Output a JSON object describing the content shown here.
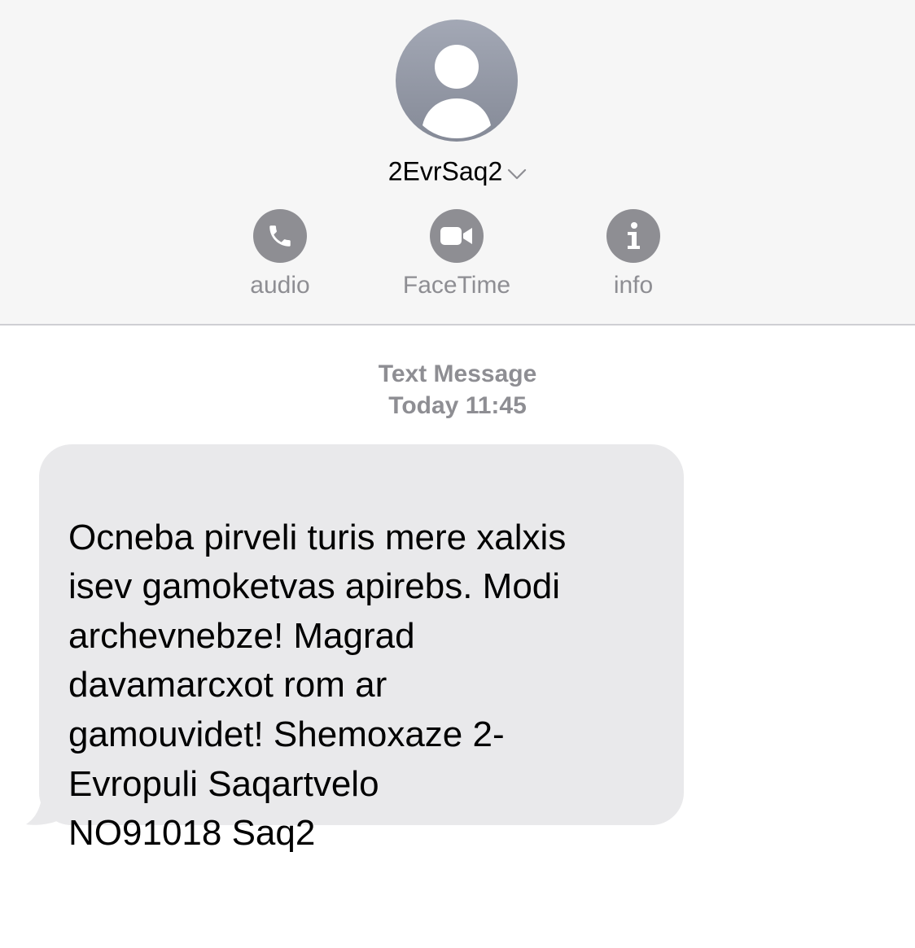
{
  "contact": {
    "name": "2EvrSaq2",
    "avatar_icon": "person-silhouette-icon",
    "expand_icon": "chevron-down-icon"
  },
  "actions": [
    {
      "label": "audio",
      "icon": "phone-icon"
    },
    {
      "label": "FaceTime",
      "icon": "video-camera-icon"
    },
    {
      "label": "info",
      "icon": "info-icon"
    }
  ],
  "thread": {
    "message_type": "Text Message",
    "timestamp": "Today 11:45"
  },
  "message": {
    "text": "Ocneba pirveli turis mere xalxis\nisev gamoketvas apirebs. Modi\narchevnebze! Magrad\ndavamarcxot rom ar\ngamouvidet! Shemoxaze 2-\nEvropuli Saqartvelo\nNO91018 Saq2"
  },
  "colors": {
    "header_bg": "#f6f6f6",
    "icon_gray": "#8e8e93",
    "bubble_bg": "#e9e9eb",
    "avatar_gray": "#9ba0ad"
  }
}
